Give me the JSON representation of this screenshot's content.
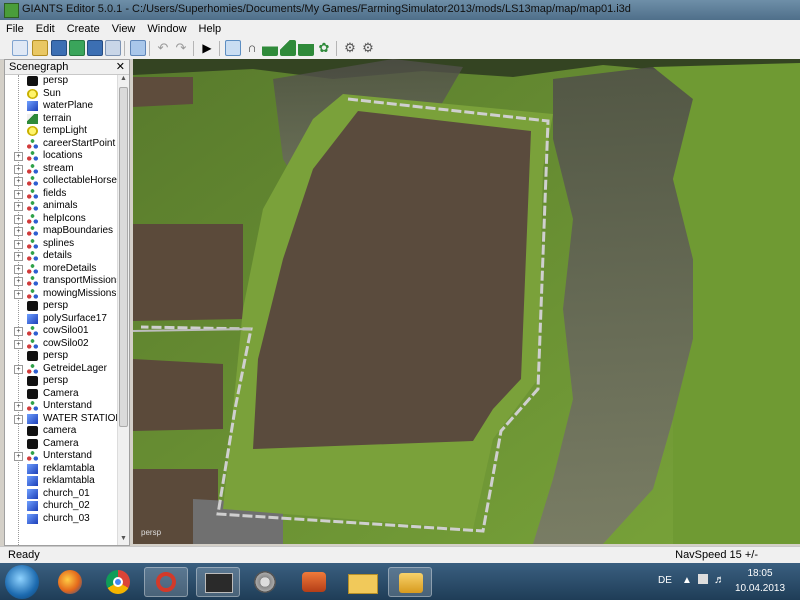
{
  "window": {
    "title": "GIANTS Editor 5.0.1 - C:/Users/Superhomies/Documents/My Games/FarmingSimulator2013/mods/LS13map/map/map01.i3d"
  },
  "menu": [
    "File",
    "Edit",
    "Create",
    "View",
    "Window",
    "Help"
  ],
  "toolbar_icons": [
    "new-icon",
    "open-icon",
    "save-icon",
    "save-as-icon",
    "refresh-icon",
    "export-icon",
    "import-icon",
    "undo-icon",
    "redo-icon",
    "play-icon",
    "home-icon",
    "magnet-icon",
    "terrain-paint-icon",
    "terrain-sculpt-icon",
    "foliage-paint-icon",
    "plant-icon",
    "settings-icon",
    "settings-alt-icon"
  ],
  "scenegraph": {
    "title": "Scenegraph",
    "close": "✕",
    "items": [
      {
        "label": "persp",
        "icon": "camera",
        "expandable": false
      },
      {
        "label": "Sun",
        "icon": "light",
        "expandable": false
      },
      {
        "label": "waterPlane",
        "icon": "cube",
        "expandable": false
      },
      {
        "label": "terrain",
        "icon": "terrain",
        "expandable": false
      },
      {
        "label": "tempLight",
        "icon": "light",
        "expandable": false
      },
      {
        "label": "careerStartPoint",
        "icon": "group",
        "expandable": false
      },
      {
        "label": "locations",
        "icon": "group",
        "expandable": true
      },
      {
        "label": "stream",
        "icon": "group",
        "expandable": true
      },
      {
        "label": "collectableHorses",
        "icon": "group",
        "expandable": true
      },
      {
        "label": "fields",
        "icon": "group",
        "expandable": true
      },
      {
        "label": "animals",
        "icon": "group",
        "expandable": true
      },
      {
        "label": "helpIcons",
        "icon": "group",
        "expandable": true
      },
      {
        "label": "mapBoundaries",
        "icon": "group",
        "expandable": true
      },
      {
        "label": "splines",
        "icon": "group",
        "expandable": true
      },
      {
        "label": "details",
        "icon": "group",
        "expandable": true
      },
      {
        "label": "moreDetails",
        "icon": "group",
        "expandable": true
      },
      {
        "label": "transportMissions",
        "icon": "group",
        "expandable": true
      },
      {
        "label": "mowingMissions",
        "icon": "group",
        "expandable": true
      },
      {
        "label": "persp",
        "icon": "camera",
        "expandable": false
      },
      {
        "label": "polySurface17",
        "icon": "cube",
        "expandable": false
      },
      {
        "label": "cowSilo01",
        "icon": "group",
        "expandable": true
      },
      {
        "label": "cowSilo02",
        "icon": "group",
        "expandable": true
      },
      {
        "label": "persp",
        "icon": "camera",
        "expandable": false
      },
      {
        "label": "GetreideLager",
        "icon": "group",
        "expandable": true
      },
      {
        "label": "persp",
        "icon": "camera",
        "expandable": false
      },
      {
        "label": "Camera",
        "icon": "camera",
        "expandable": false
      },
      {
        "label": "Unterstand",
        "icon": "group",
        "expandable": true
      },
      {
        "label": "WATER STATION",
        "icon": "cube",
        "expandable": true
      },
      {
        "label": "camera",
        "icon": "camera",
        "expandable": false
      },
      {
        "label": "Camera",
        "icon": "camera",
        "expandable": false
      },
      {
        "label": "Unterstand",
        "icon": "group",
        "expandable": true
      },
      {
        "label": "reklamtabla",
        "icon": "cube",
        "expandable": false
      },
      {
        "label": "reklamtabla",
        "icon": "cube",
        "expandable": false
      },
      {
        "label": "church_01",
        "icon": "cube",
        "expandable": false
      },
      {
        "label": "church_02",
        "icon": "cube",
        "expandable": false
      },
      {
        "label": "church_03",
        "icon": "cube",
        "expandable": false
      }
    ]
  },
  "viewport": {
    "camera_label": "persp"
  },
  "status": {
    "left": "Ready",
    "right": "NavSpeed 15 +/-"
  },
  "taskbar": {
    "apps": [
      "firefox-icon",
      "chrome-icon",
      "opera-icon",
      "audio-editor-icon",
      "media-icon",
      "video-icon",
      "folder-icon",
      "giants-editor-icon"
    ],
    "language": "DE",
    "time": "18:05",
    "date": "10.04.2013"
  },
  "colors": {
    "grass": "#6b8e2f",
    "field": "#5a4a3a",
    "path": "#c8c8c8",
    "rock": "#6e6a60"
  }
}
